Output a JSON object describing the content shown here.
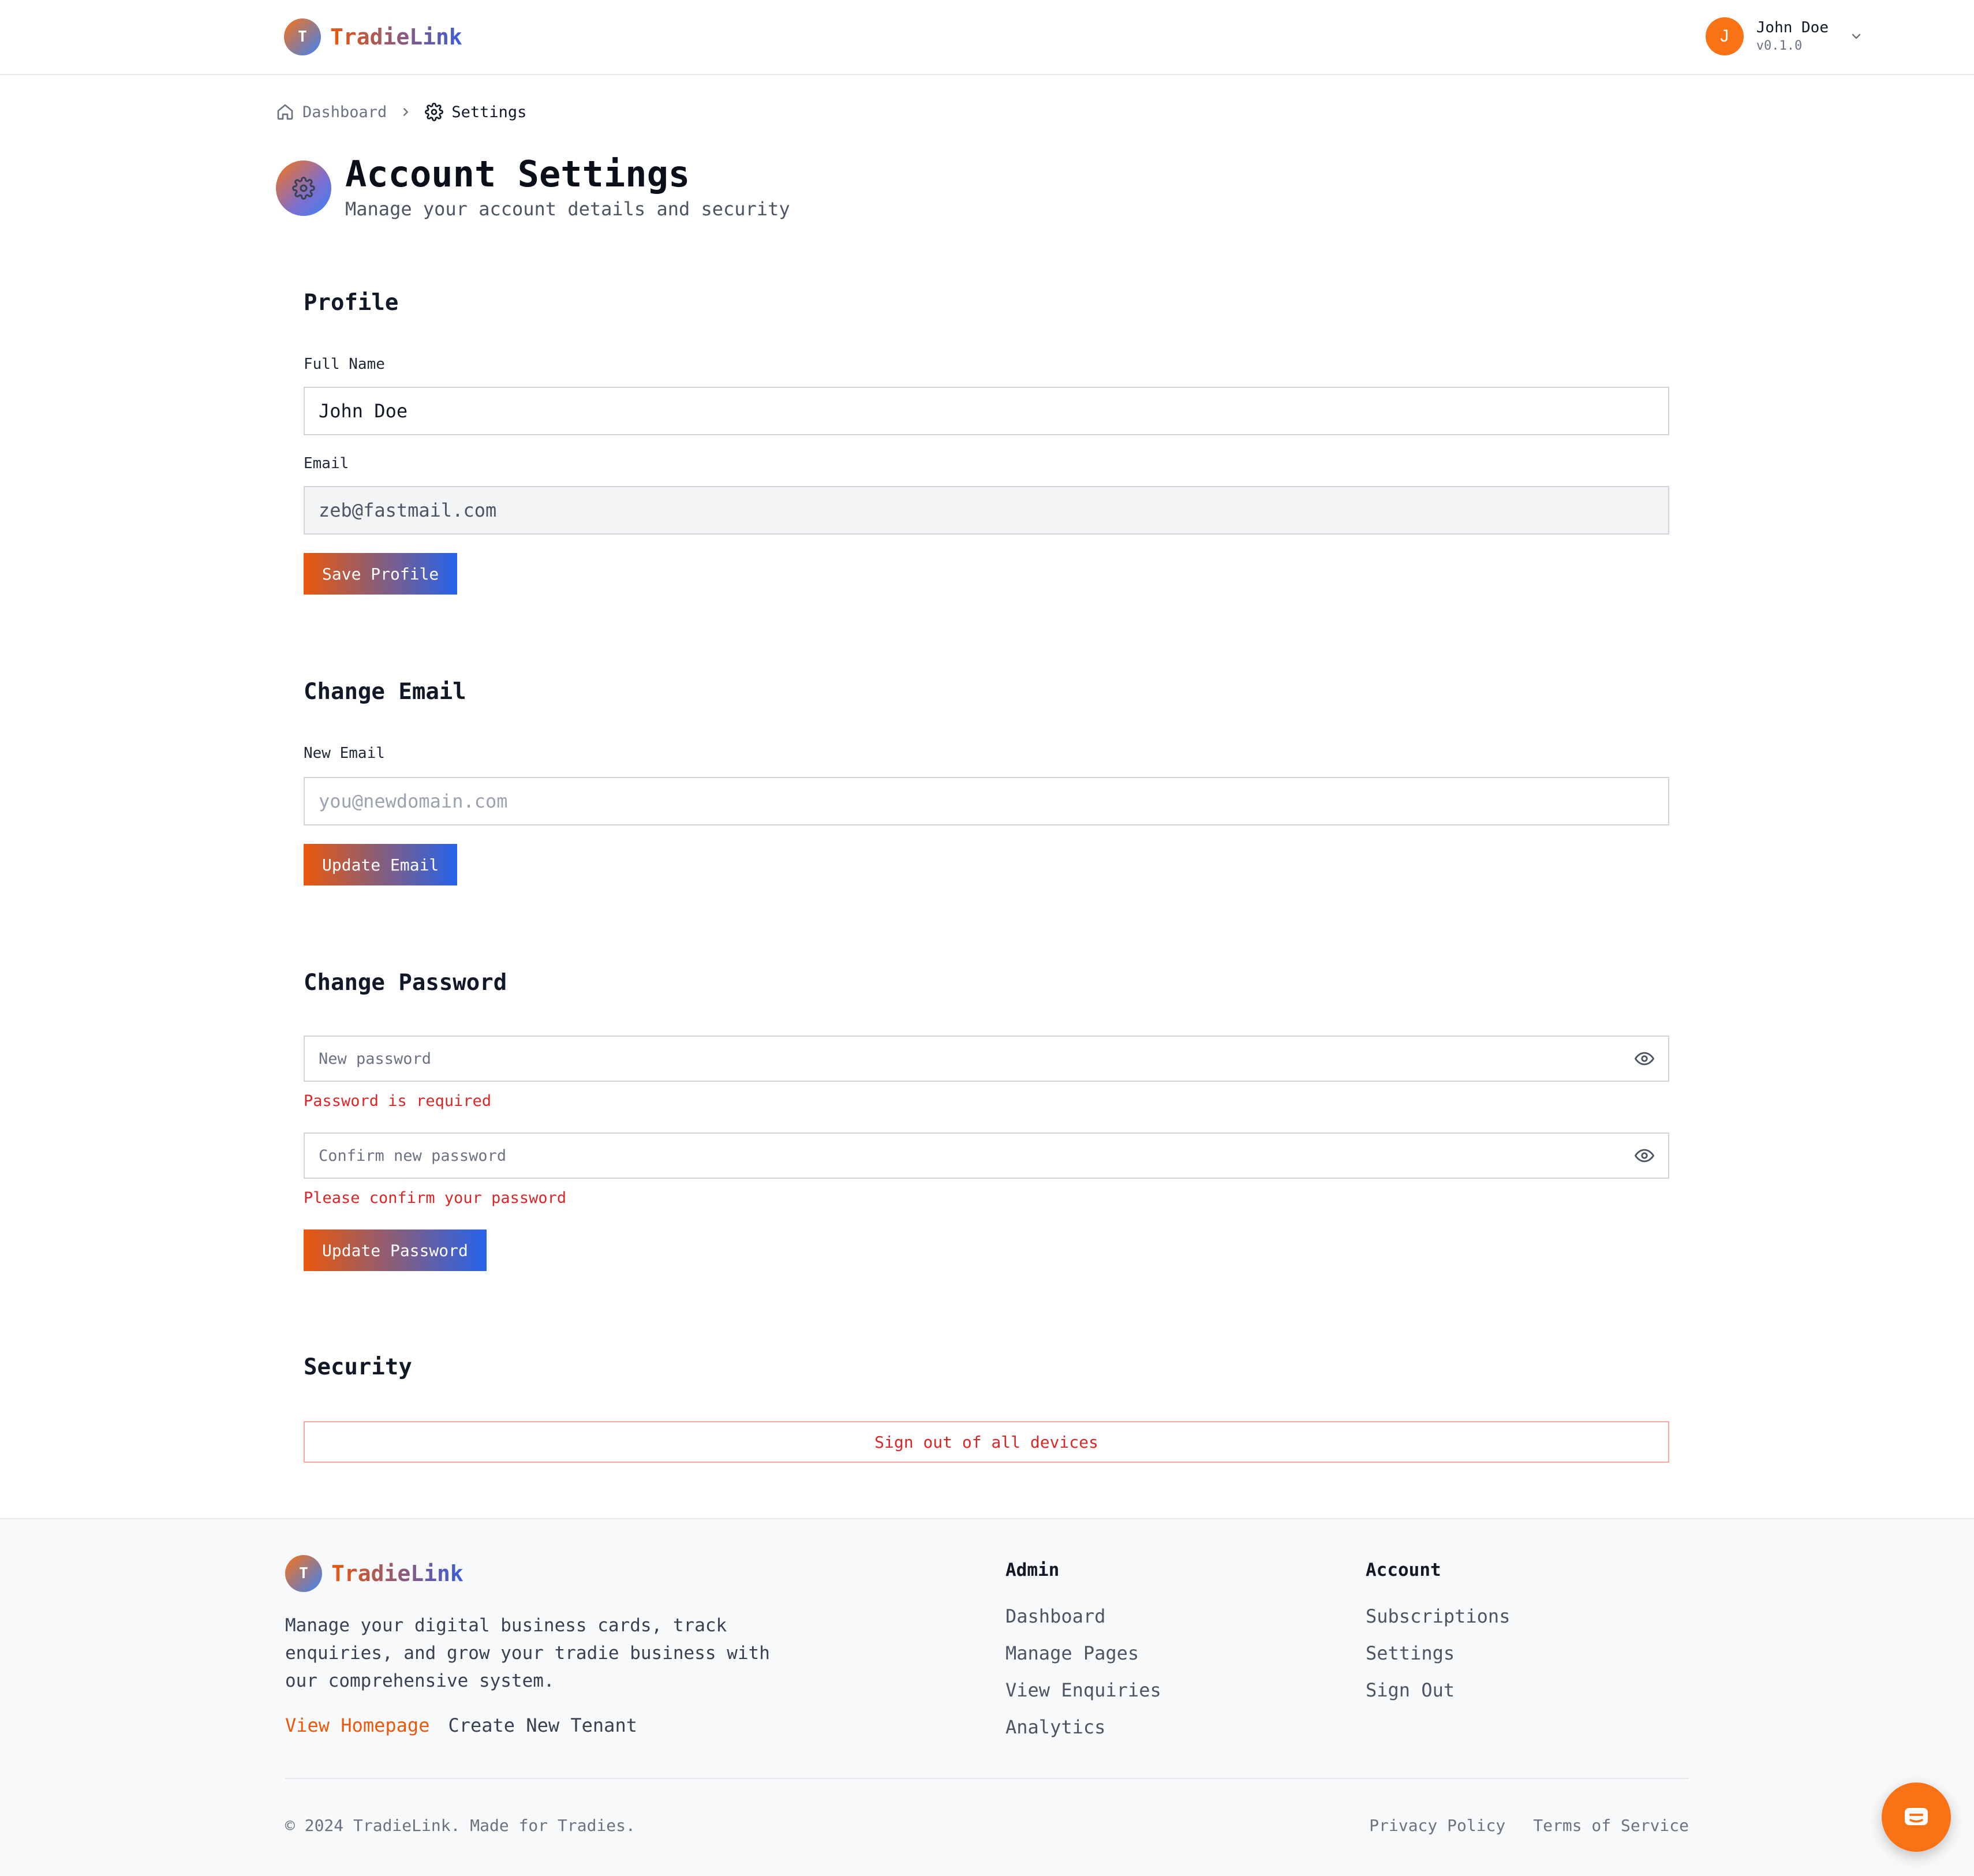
{
  "app": {
    "brand": "TradieLink",
    "brand_initial": "T",
    "accent": "#f97316",
    "accent_end": "#2563eb"
  },
  "header": {
    "user": {
      "initial": "J",
      "name": "John Doe",
      "version": "v0.1.0"
    }
  },
  "breadcrumb": {
    "items": [
      "Dashboard",
      "Settings"
    ]
  },
  "page": {
    "title": "Account Settings",
    "subtitle": "Manage your account details and security"
  },
  "profile": {
    "title": "Profile",
    "full_name_label": "Full Name",
    "full_name_value": "John Doe",
    "email_label": "Email",
    "email_value": "zeb@fastmail.com",
    "save_label": "Save Profile"
  },
  "change_email": {
    "title": "Change Email",
    "new_email_label": "New Email",
    "new_email_placeholder": "you@newdomain.com",
    "update_label": "Update Email"
  },
  "change_password": {
    "title": "Change Password",
    "new_password_placeholder": "New password",
    "new_password_error": "Password is required",
    "confirm_placeholder": "Confirm new password",
    "confirm_error": "Please confirm your password",
    "update_label": "Update Password"
  },
  "security": {
    "title": "Security",
    "sign_out_all_label": "Sign out of all devices"
  },
  "footer": {
    "brand": "TradieLink",
    "brand_initial": "T",
    "description": "Manage your digital business cards, track enquiries, and grow your tradie business with our comprehensive system.",
    "link_homepage": "View Homepage",
    "link_new_tenant": "Create New Tenant",
    "admin": {
      "title": "Admin",
      "items": [
        "Dashboard",
        "Manage Pages",
        "View Enquiries",
        "Analytics"
      ]
    },
    "account": {
      "title": "Account",
      "items": [
        "Subscriptions",
        "Settings",
        "Sign Out"
      ]
    },
    "copyright": "© 2024 TradieLink. Made for Tradies.",
    "privacy": "Privacy Policy",
    "terms": "Terms of Service"
  },
  "icons": {
    "home": "home-icon",
    "chevron_right": "chevron-right-icon",
    "gear": "gear-icon",
    "chevron_down": "chevron-down-icon",
    "eye": "eye-icon",
    "chat": "chat-icon"
  }
}
